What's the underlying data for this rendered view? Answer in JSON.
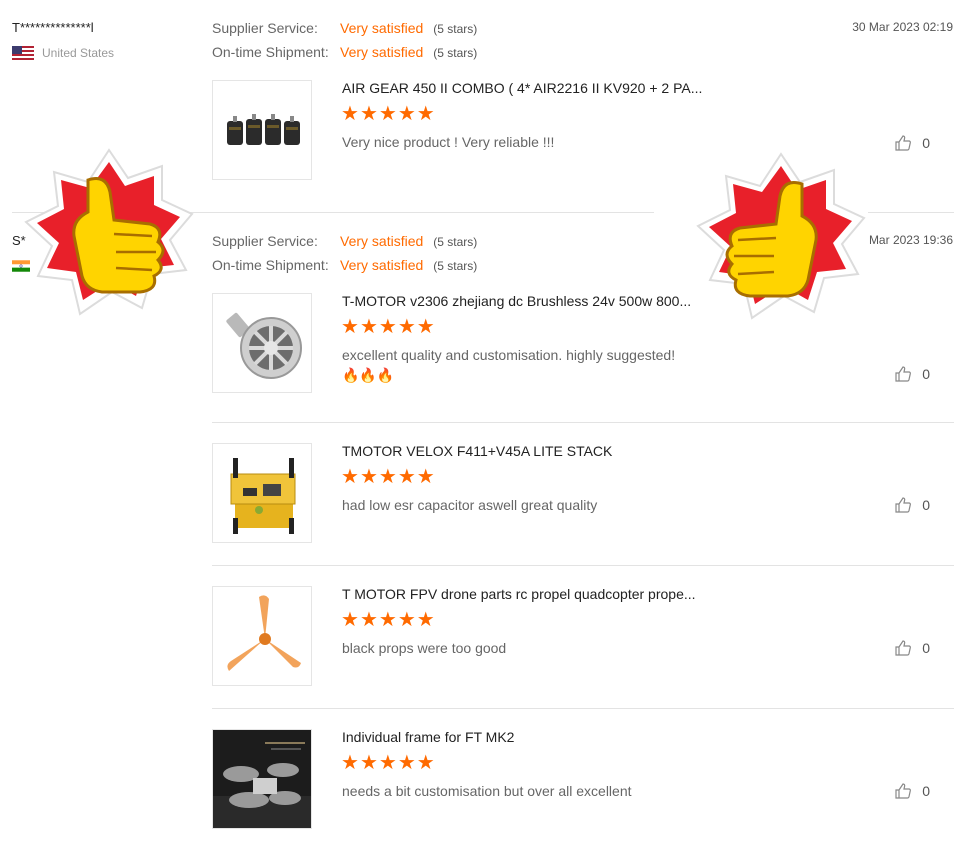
{
  "reviews": [
    {
      "name": "T**************l",
      "country": "United States",
      "supplier_label": "Supplier Service:",
      "supplier_value": "Very satisfied",
      "supplier_stars": "(5 stars)",
      "shipment_label": "On-time Shipment:",
      "shipment_value": "Very satisfied",
      "shipment_stars": "(5 stars)",
      "date": "30 Mar 2023 02:19",
      "items": [
        {
          "title": "AIR GEAR 450 II COMBO ( 4* AIR2216 II KV920 + 2 PA...",
          "rating": 5,
          "comment": "Very nice product ! Very reliable !!!",
          "likes": "0"
        }
      ]
    },
    {
      "name": "S*",
      "country": "",
      "supplier_label": "Supplier Service:",
      "supplier_value": "Very satisfied",
      "supplier_stars": "(5 stars)",
      "shipment_label": "On-time Shipment:",
      "shipment_value": "Very satisfied",
      "shipment_stars": "(5 stars)",
      "date": "Mar 2023 19:36",
      "items": [
        {
          "title": "T-MOTOR v2306 zhejiang dc Brushless 24v 500w 800...",
          "rating": 5,
          "comment": "excellent quality and customisation. highly suggested!",
          "comment_emoji": "🔥🔥🔥",
          "likes": "0"
        },
        {
          "title": "TMOTOR VELOX F411+V45A LITE STACK",
          "rating": 5,
          "comment": "had low esr capacitor aswell great quality",
          "likes": "0"
        },
        {
          "title": "T MOTOR FPV drone parts rc propel quadcopter prope...",
          "rating": 5,
          "comment": "black props were too good",
          "likes": "0"
        },
        {
          "title": "Individual frame for FT MK2",
          "rating": 5,
          "comment": "needs a bit customisation but over all excellent",
          "likes": "0"
        }
      ]
    }
  ],
  "colors": {
    "accent": "#ff6a00",
    "sticker_red": "#e8202a",
    "sticker_yellow": "#ffd400"
  },
  "icons": {
    "like": "thumbs-up-outline-icon",
    "star": "star-icon",
    "sticker": "thumbs-up-sticker"
  }
}
